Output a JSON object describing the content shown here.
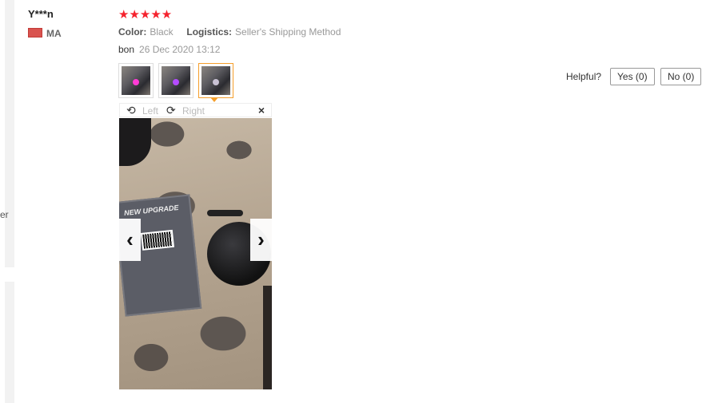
{
  "left_edge_text": "er",
  "review": {
    "username": "Y***n",
    "country_code": "MA",
    "flag_color": "#d9534f",
    "stars": "★★★★★",
    "rating": 5,
    "star_color": "#f5222d",
    "color_label": "Color:",
    "color_value": "Black",
    "logistics_label": "Logistics:",
    "logistics_value": "Seller's Shipping Method",
    "text": "bon",
    "date": "26 Dec 2020 13:12",
    "helpful_label": "Helpful?",
    "yes_label": "Yes (0)",
    "no_label": "No (0)",
    "thumbnail_count": 3,
    "active_thumbnail_index": 2,
    "active_border_color": "#f59f2c"
  },
  "viewer": {
    "rotate_left_icon": "rotate-left-icon",
    "rotate_left_label": "Left",
    "rotate_right_icon": "rotate-right-icon",
    "rotate_right_label": "Right",
    "close_symbol": "×",
    "prev_symbol": "‹",
    "next_symbol": "›",
    "box_header_text": "NEW UPGRADE"
  }
}
